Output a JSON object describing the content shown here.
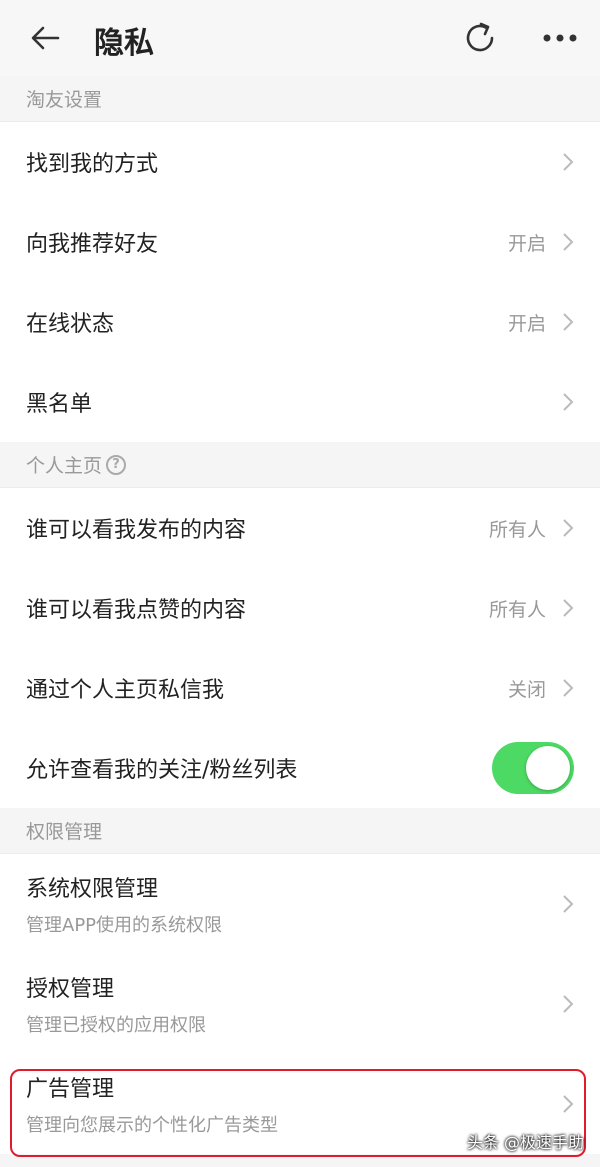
{
  "header": {
    "title": "隐私"
  },
  "sections": {
    "taoyou": {
      "title": "淘友设置"
    },
    "profile": {
      "title": "个人主页"
    },
    "permissions": {
      "title": "权限管理"
    }
  },
  "rows": {
    "find_me": {
      "label": "找到我的方式",
      "value": ""
    },
    "recommend": {
      "label": "向我推荐好友",
      "value": "开启"
    },
    "online": {
      "label": "在线状态",
      "value": "开启"
    },
    "blacklist": {
      "label": "黑名单",
      "value": ""
    },
    "who_posts": {
      "label": "谁可以看我发布的内容",
      "value": "所有人"
    },
    "who_likes": {
      "label": "谁可以看我点赞的内容",
      "value": "所有人"
    },
    "dm": {
      "label": "通过个人主页私信我",
      "value": "关闭"
    },
    "follow_list": {
      "label": "允许查看我的关注/粉丝列表",
      "toggle_on": true
    },
    "sys_perm": {
      "label": "系统权限管理",
      "sub": "管理APP使用的系统权限"
    },
    "auth": {
      "label": "授权管理",
      "sub": "管理已授权的应用权限"
    },
    "ads": {
      "label": "广告管理",
      "sub": "管理向您展示的个性化广告类型"
    }
  },
  "watermark": "头条 @极速手助",
  "colors": {
    "toggle_on": "#4cd964",
    "highlight": "#e21b2c"
  }
}
